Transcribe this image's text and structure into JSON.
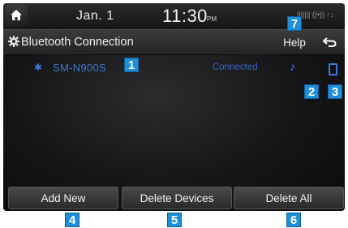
{
  "status_bar": {
    "date": "Jan.  1",
    "time": "11:30",
    "ampm": "PM",
    "status_icons": "|||||||  ((•))  ↑↓"
  },
  "title_bar": {
    "title": "Bluetooth Connection",
    "help_label": "Help"
  },
  "device": {
    "name": "SM-N900S",
    "status": "Connected"
  },
  "buttons": {
    "add_new": "Add New",
    "delete_devices": "Delete Devices",
    "delete_all": "Delete All"
  },
  "callouts": {
    "c1": "1",
    "c2": "2",
    "c3": "3",
    "c4": "4",
    "c5": "5",
    "c6": "6",
    "c7": "7"
  },
  "icons": [
    "home-icon",
    "gear-icon",
    "back-icon",
    "bluetooth-icon",
    "audio-icon",
    "phone-icon"
  ],
  "colors": {
    "accent_blue": "#3b78d8",
    "callout_blue": "#1f8fd9"
  }
}
